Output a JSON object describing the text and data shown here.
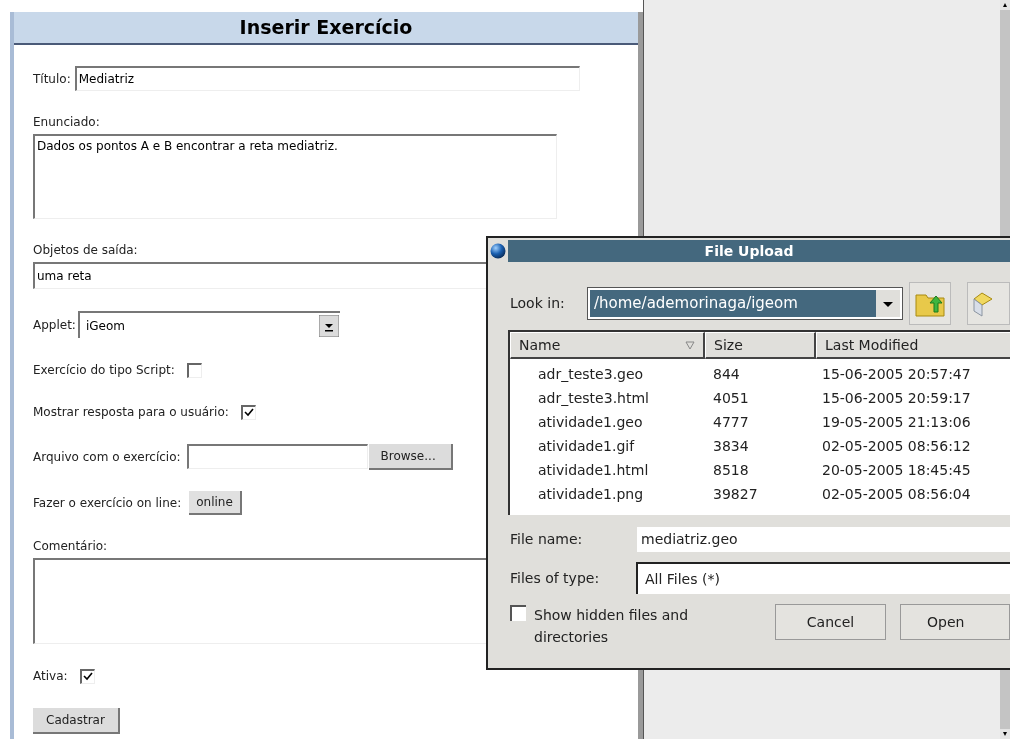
{
  "page": {
    "title": "Inserir Exercício"
  },
  "form": [
    {
      "kind": "text",
      "label": "Título:",
      "value": "Mediatriz"
    },
    {
      "kind": "textarea",
      "label": "Enunciado:",
      "value": "Dados os pontos A e B encontrar a reta mediatriz."
    },
    {
      "kind": "wide_text",
      "label": "Objetos de saída:",
      "value": "uma reta"
    },
    {
      "kind": "select",
      "label": "Applet:",
      "value": "iGeom"
    },
    {
      "kind": "checkbox",
      "label": "Exercício do tipo Script:",
      "checked": false
    },
    {
      "kind": "checkbox",
      "label": "Mostrar resposta para o usuário:",
      "checked": true
    },
    {
      "kind": "file",
      "label": "Arquivo com o exercício:",
      "button": "Browse..."
    },
    {
      "kind": "button",
      "label": "Fazer o exercício on line:",
      "button": "online"
    },
    {
      "kind": "textarea",
      "label": "Comentário:"
    },
    {
      "kind": "checkbox",
      "label": "Ativa:",
      "checked": true
    },
    {
      "kind": "submit",
      "button": "Cadastrar"
    }
  ],
  "dialog": {
    "title": "File Upload",
    "look_in_label": "Look in:",
    "look_in": "/home/ademorinaga/igeom",
    "columns": [
      "Name",
      "Size",
      "Last Modified"
    ],
    "rows": [
      [
        "adr_teste3.geo",
        "844",
        "15-06-2005 20:57:47"
      ],
      [
        "adr_teste3.html",
        "4051",
        "15-06-2005 20:59:17"
      ],
      [
        "atividade1.geo",
        "4777",
        "19-05-2005 21:13:06"
      ],
      [
        "atividade1.gif",
        "3834",
        "02-05-2005 08:56:12"
      ],
      [
        "atividade1.html",
        "8518",
        "20-05-2005 18:45:45"
      ],
      [
        "atividade1.png",
        "39827",
        "02-05-2005 08:56:04"
      ]
    ],
    "file_name_label": "File name:",
    "file_name": "mediatriz.geo",
    "file_type_label": "Files of type:",
    "file_type": "All Files (*)",
    "show_hidden": {
      "label": "Show hidden files and directories",
      "checked": false
    },
    "buttons": [
      "Cancel",
      "Open"
    ]
  }
}
